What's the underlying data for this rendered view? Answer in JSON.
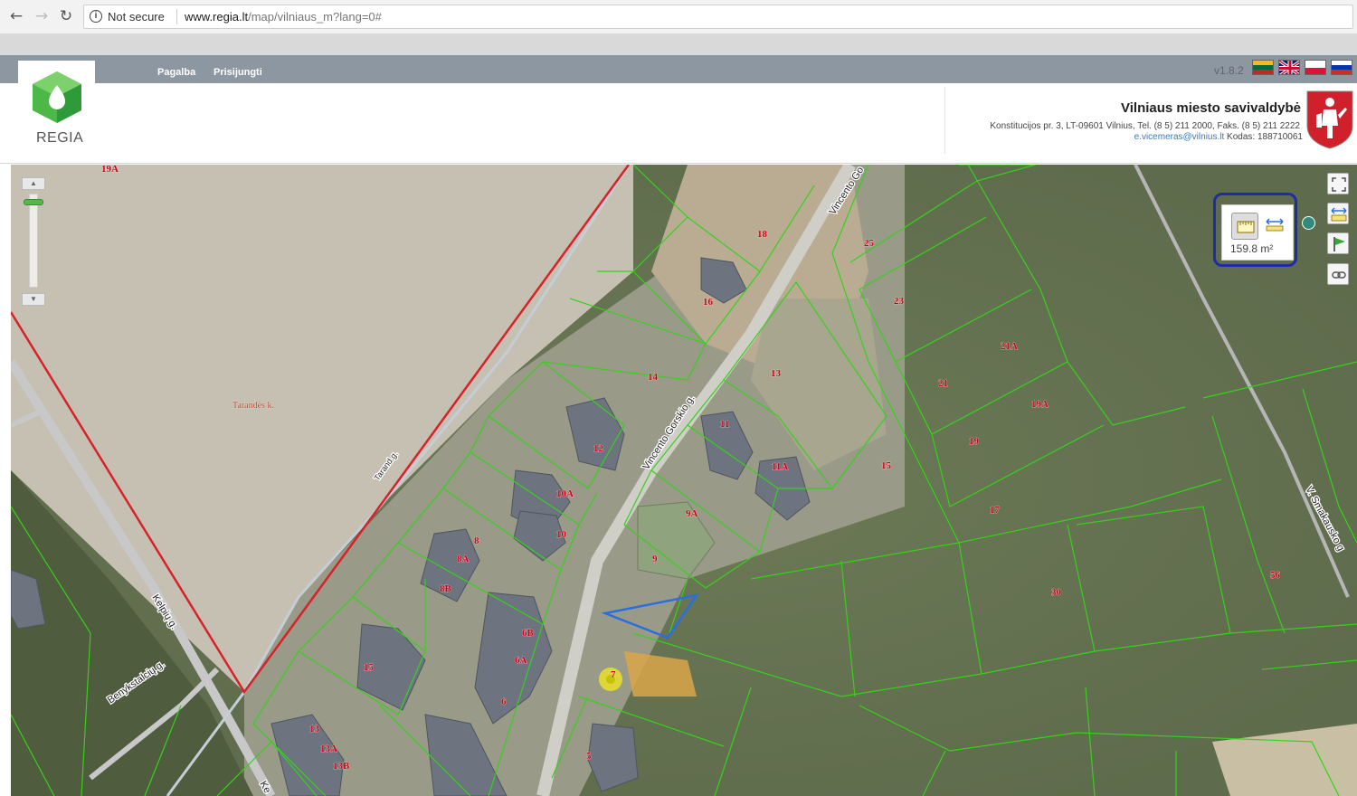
{
  "browser": {
    "url_warning": "Not secure",
    "url_host": "www.regia.lt",
    "url_path": "/map/vilniaus_m?lang=0#"
  },
  "app": {
    "logo_text": "REGIA",
    "menu": {
      "help": "Pagalba",
      "login": "Prisijungti"
    },
    "version": "v1.8.2",
    "languages": [
      "lt",
      "en",
      "pl",
      "ru"
    ]
  },
  "municipality": {
    "name": "Vilniaus miesto savivaldybė",
    "address": "Konstitucijos pr. 3, LT-09601 Vilnius, Tel. (8 5) 211 2000, Faks. (8 5) 211 2222",
    "email": "e.vicemeras@vilnius.lt",
    "code": "Kodas: 188710061"
  },
  "measure": {
    "value": "159.8 m²"
  },
  "map": {
    "plot_labels": [
      "19A",
      "18",
      "16",
      "14",
      "13",
      "12",
      "11",
      "11A",
      "10A",
      "10",
      "9A",
      "9",
      "8",
      "8A",
      "8B",
      "7",
      "6B",
      "6A",
      "6",
      "5",
      "15",
      "15",
      "13",
      "13A",
      "13B",
      "25",
      "23",
      "21A",
      "21",
      "19A",
      "19",
      "17",
      "30",
      "56",
      "Tarandės k."
    ],
    "street_labels": [
      "Vincento Gorskio g.",
      "Vincento Go",
      "Kelpių g.",
      "Benykstalcių g.",
      "Tarand.g.",
      "V. Smakausko g",
      "Ke"
    ]
  },
  "colors": {
    "plot_border": "#34d21a",
    "restricted_border": "#d8222a",
    "selection": "#2a6fe0",
    "topbar": "#8d97a1"
  }
}
